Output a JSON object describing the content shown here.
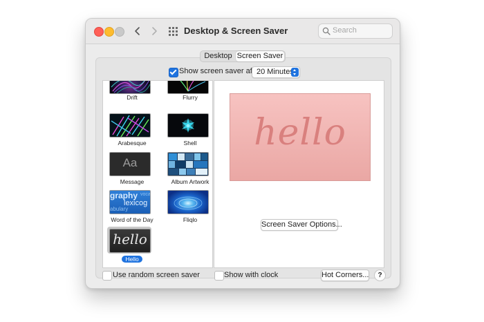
{
  "window": {
    "title": "Desktop & Screen Saver",
    "search_placeholder": "Search",
    "traffic_colors": [
      "#ff5f57",
      "#febc2e",
      "#c9c9c9"
    ],
    "accent": "#1f73df",
    "icons": [
      "back-chevron",
      "forward-chevron",
      "grid-of-dots",
      "magnifier"
    ]
  },
  "tabs": [
    {
      "label": "Desktop",
      "selected": false
    },
    {
      "label": "Screen Saver",
      "selected": true
    }
  ],
  "show_after": {
    "checked": true,
    "label": "Show screen saver after",
    "value": "20 Minutes"
  },
  "savers": [
    {
      "name": "Drift"
    },
    {
      "name": "Flurry"
    },
    {
      "name": "Arabesque"
    },
    {
      "name": "Shell"
    },
    {
      "name": "Message",
      "thumb_text": "Aa"
    },
    {
      "name": "Album Artwork"
    },
    {
      "name": "Word of the Day",
      "thumb_text": "graphy",
      "thumb_text2": "lexicog",
      "thumb_text3": "abulary",
      "thumb_text4": "voca"
    },
    {
      "name": "Fliqlo"
    },
    {
      "name": "Hello",
      "selected": true,
      "thumb_text": "hello"
    }
  ],
  "preview": {
    "text": "hello",
    "options_label": "Screen Saver Options..."
  },
  "bottom": {
    "random_label": "Use random screen saver",
    "random_checked": false,
    "clock_label": "Show with clock",
    "clock_checked": false,
    "hot_corners_label": "Hot Corners...",
    "help_label": "?"
  }
}
